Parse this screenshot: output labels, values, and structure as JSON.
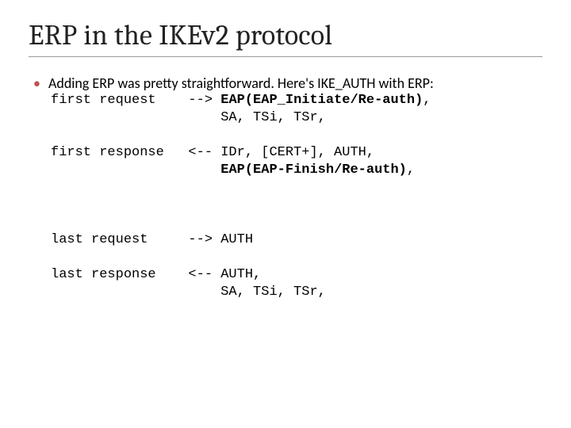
{
  "title": "ERP in the IKEv2 protocol",
  "bullet_text": "Adding ERP was pretty straightforward. Here's IKE_AUTH with ERP:",
  "code": {
    "l1a": "first request    --> ",
    "l1b": "EAP(EAP_Initiate/Re-auth)",
    "l1c": ",",
    "l2": "                     SA, TSi, TSr,",
    "blank1": "",
    "l3": "first response   <-- IDr, [CERT+], AUTH,",
    "l4a": "                     ",
    "l4b": "EAP(EAP-Finish/Re-auth)",
    "l4c": ",",
    "blank2": "",
    "blank3": "",
    "blank4": "",
    "l5": "last request     --> AUTH",
    "blank5": "",
    "l6": "last response    <-- AUTH,",
    "l7": "                     SA, TSi, TSr,"
  }
}
